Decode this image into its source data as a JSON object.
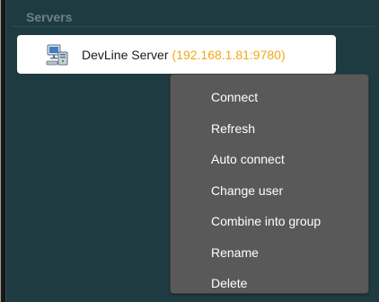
{
  "section": {
    "title": "Servers"
  },
  "server": {
    "name": "DevLine Server",
    "address": "(192.168.1.81:9780)",
    "icon": "network-server-icon"
  },
  "context_menu": {
    "items": [
      {
        "label": "Connect"
      },
      {
        "label": "Refresh"
      },
      {
        "label": "Auto connect"
      },
      {
        "label": "Change user"
      },
      {
        "label": "Combine into group"
      },
      {
        "label": "Rename"
      },
      {
        "label": "Delete"
      }
    ]
  },
  "colors": {
    "panel_background": "#1f3b42",
    "section_title": "#6d8187",
    "item_selected_background": "#ffffff",
    "address_text": "#f0a81a",
    "menu_background": "#595959",
    "menu_text": "#ffffff"
  }
}
